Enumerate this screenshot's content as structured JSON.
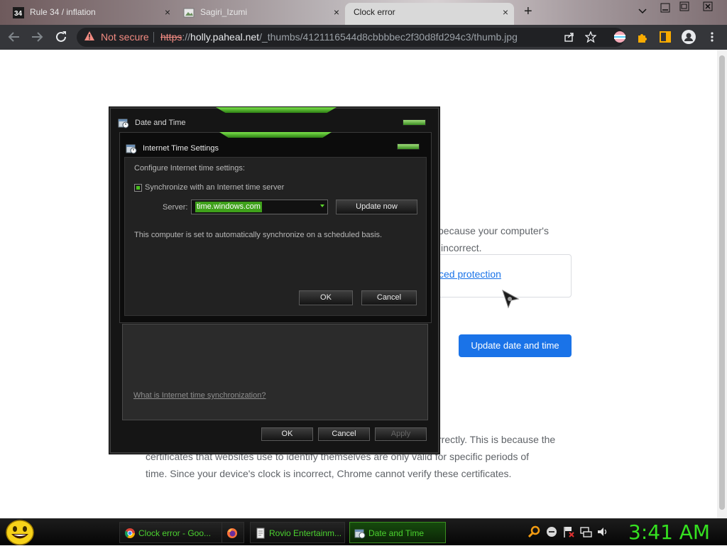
{
  "browser": {
    "tabs": [
      {
        "label": "Rule 34 / inflation",
        "favicon": "r34-favicon"
      },
      {
        "label": "Sagiri_Izumi",
        "favicon": "image-favicon"
      },
      {
        "label": "Clock error",
        "favicon": "none",
        "active": true
      }
    ],
    "close_glyph": "×",
    "new_tab_glyph": "+",
    "address": {
      "security_label": "Not secure",
      "url_scheme": "https",
      "url_host": "holly.paheal.net",
      "url_path": "/_thumbs/4121116544d8cbbbbec2f30d8fd294c3/thumb.jpg"
    }
  },
  "page": {
    "para1_line1": "because your computer's",
    "para1_line2": "incorrect.",
    "enhanced_link": "ced protection",
    "update_button": "Update date and time",
    "para2_line1": "rrectly. This is because the",
    "para2_line2": "certificates that websites use to identify themselves are only valid for specific periods of",
    "para2_line3": "time. Since your device's clock is incorrect, Chrome cannot verify these certificates."
  },
  "date_time_dialog": {
    "title": "Date and Time",
    "help_link": "What is Internet time synchronization?",
    "ok": "OK",
    "cancel": "Cancel",
    "apply": "Apply"
  },
  "internet_time_dialog": {
    "title": "Internet Time Settings",
    "heading": "Configure Internet time settings:",
    "sync_label": "Synchronize with an Internet time server",
    "sync_checked": true,
    "server_label": "Server:",
    "server_value": "time.windows.com",
    "update_now": "Update now",
    "status": "This computer is set to automatically synchronize on a scheduled basis.",
    "ok": "OK",
    "cancel": "Cancel"
  },
  "taskbar": {
    "items": [
      {
        "label": "Clock error - Goo...",
        "icon": "chrome-icon"
      },
      {
        "label": "",
        "icon": "firefox-icon"
      },
      {
        "label": "Rovio Entertainm...",
        "icon": "document-icon"
      },
      {
        "label": "Date and Time",
        "icon": "clock-icon",
        "active": true
      }
    ],
    "clock": "3:41 AM"
  },
  "colors": {
    "accent_green": "#4bc11f",
    "chrome_blue": "#1a73e8",
    "not_secure_red": "#f28b82"
  }
}
